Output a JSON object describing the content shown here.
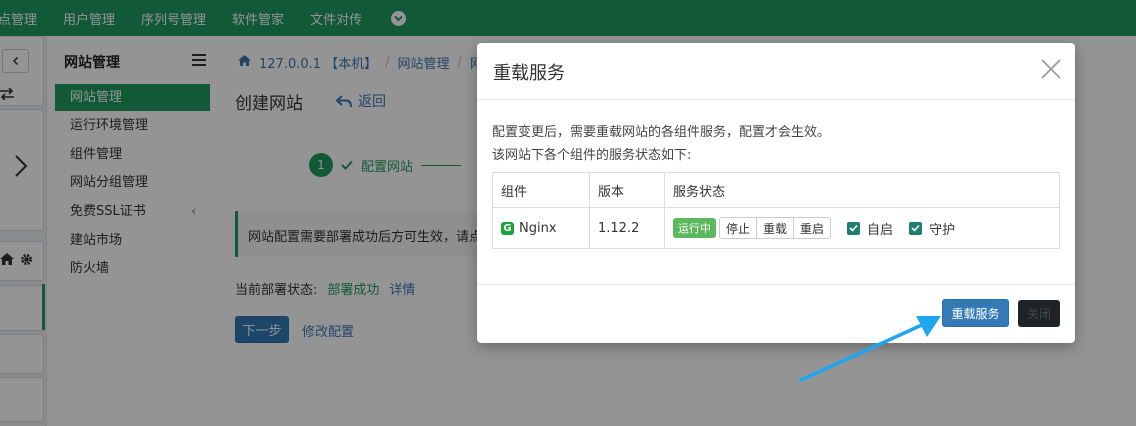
{
  "topbar": {
    "items": [
      "点管理",
      "用户管理",
      "序列号管理",
      "软件管家",
      "文件对传"
    ]
  },
  "sidebar": {
    "title": "网站管理",
    "items": [
      "网站管理",
      "运行环境管理",
      "组件管理",
      "网站分组管理",
      "免费SSL证书",
      "建站市场",
      "防火墙"
    ]
  },
  "main": {
    "breadcrumb": [
      "127.0.0.1 【本机】",
      "网站管理",
      "网"
    ],
    "title": "创建网站",
    "back_label": "返回",
    "step": {
      "number": "1",
      "label": "配置网站"
    },
    "alert": "网站配置需要部署成功后方可生效，请点",
    "deploy_status_label": "当前部署状态:",
    "deploy_status_value": "部署成功",
    "deploy_detail": "详情",
    "next_label": "下一步",
    "edit_label": "修改配置"
  },
  "modal": {
    "title": "重载服务",
    "desc_line1": "配置变更后，需要重载网站的各组件服务，配置才会生效。",
    "desc_line2": "该网站下各个组件的服务状态如下:",
    "columns": [
      "组件",
      "版本",
      "服务状态"
    ],
    "row": {
      "component": "Nginx",
      "version": "1.12.2",
      "status_badge": "运行中",
      "actions": [
        "停止",
        "重载",
        "重启"
      ],
      "autostart_label": "自启",
      "guard_label": "守护"
    },
    "reload_button": "重载服务",
    "close_button": "关闭"
  },
  "colors": {
    "brand_green": "#209c5f",
    "primary_blue": "#337ab7",
    "arrow": "#1ea7f0"
  }
}
